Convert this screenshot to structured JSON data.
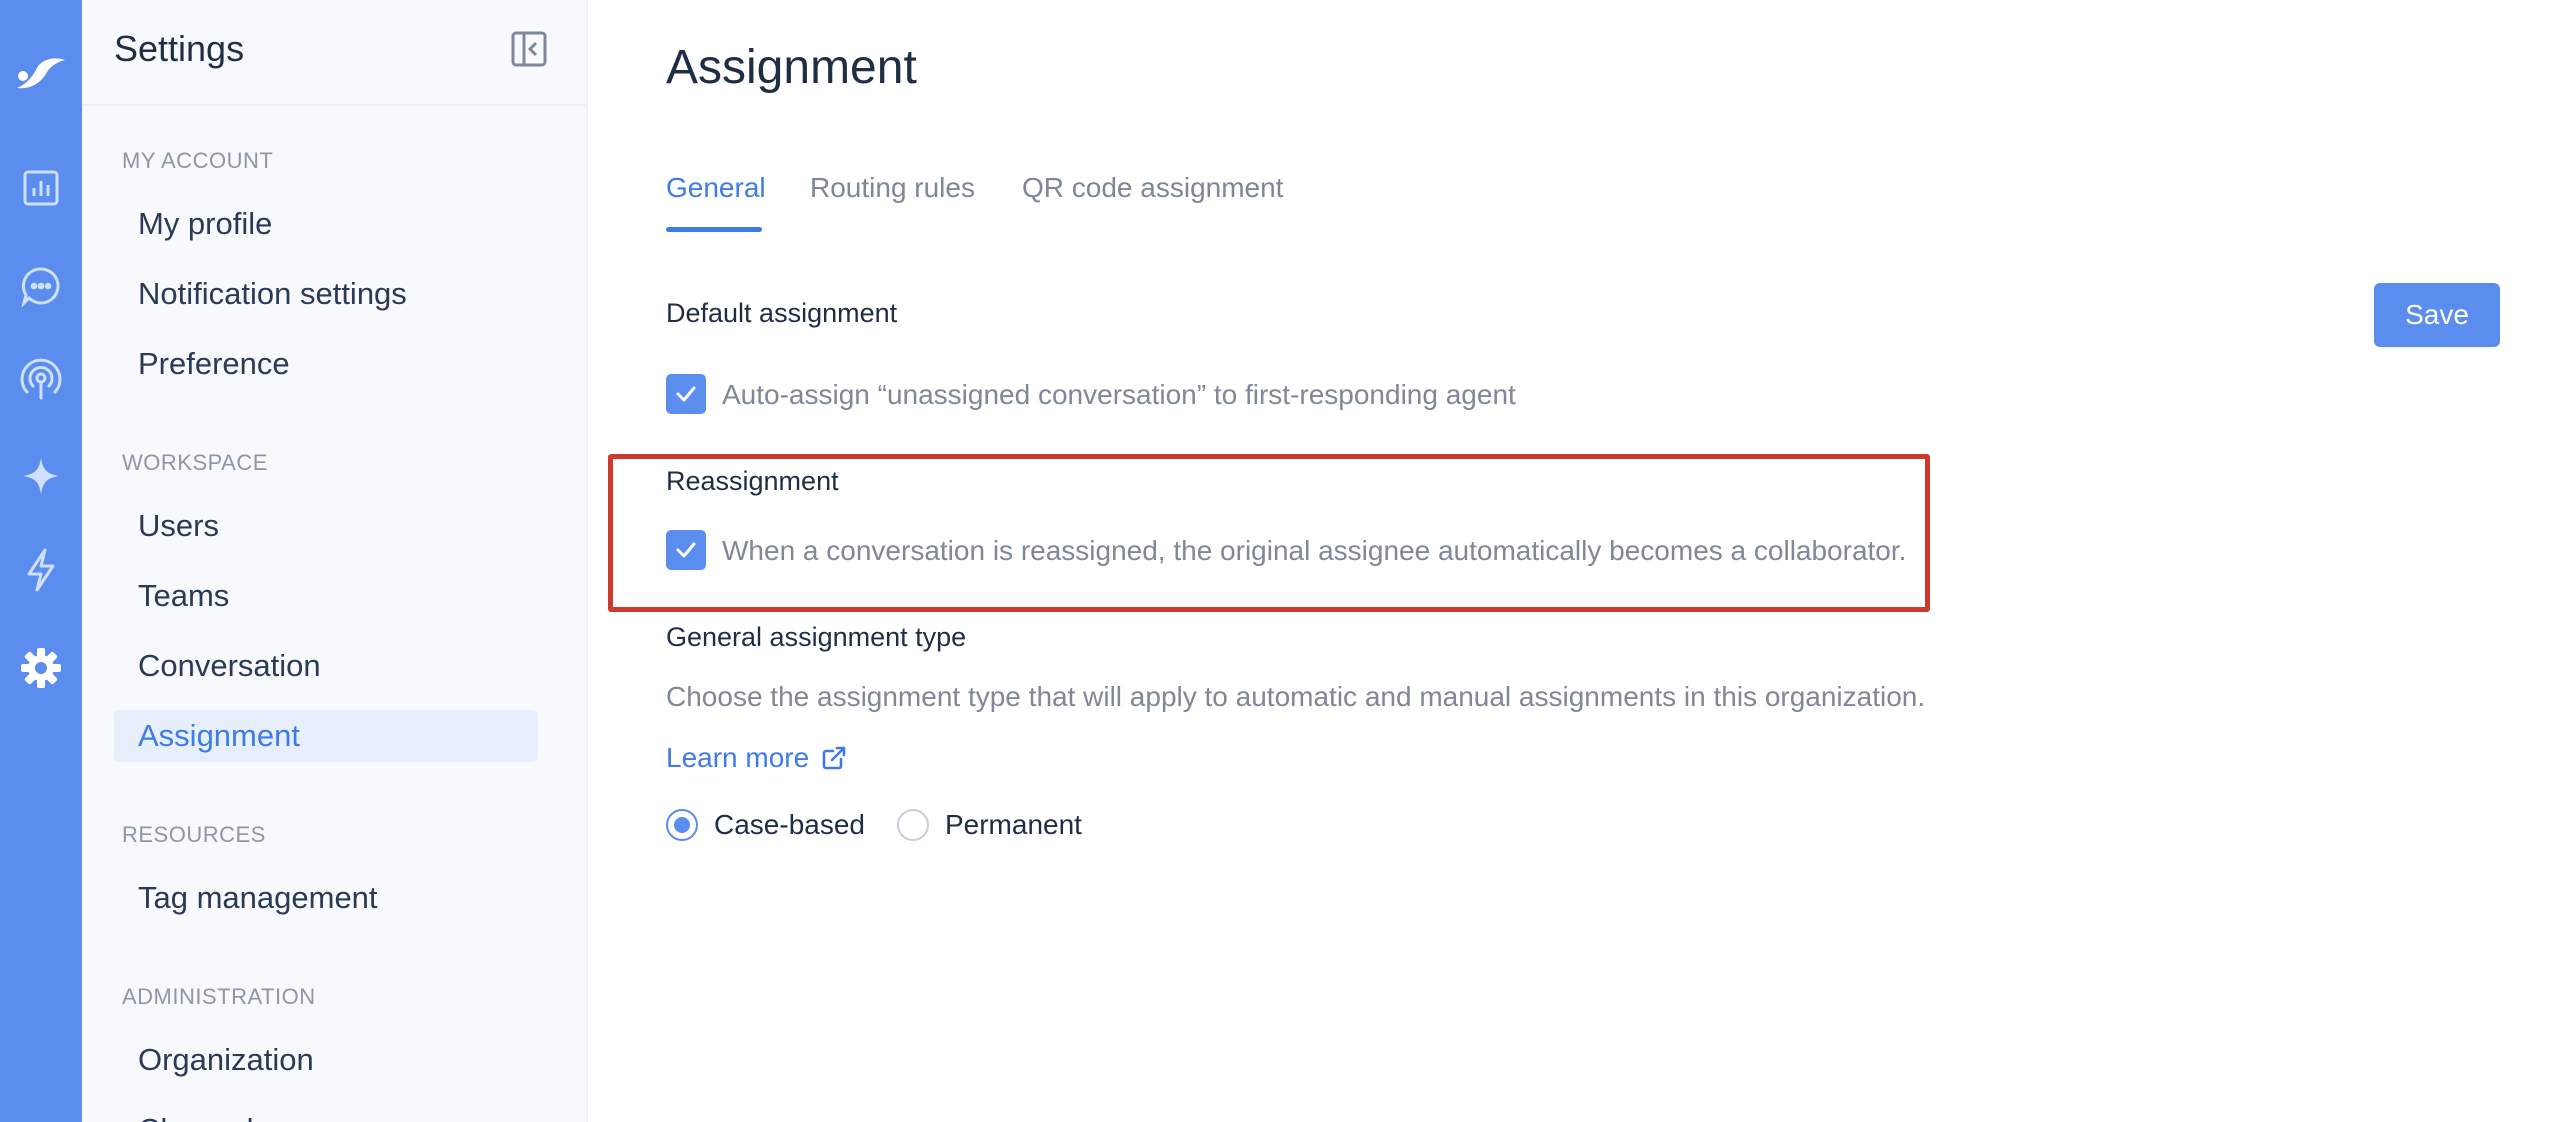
{
  "colors": {
    "primary": "#5b8def",
    "accent_text": "#3f7be6",
    "highlight_border": "#cc3a2d",
    "panel_bg": "#f7f9fc"
  },
  "rail": {
    "icons": [
      "logo-icon",
      "analytics-icon",
      "chat-icon",
      "broadcast-icon",
      "ai-sparkle-icon",
      "automation-bolt-icon",
      "settings-gear-icon"
    ]
  },
  "settings_panel": {
    "title": "Settings",
    "sections": [
      {
        "heading": "MY ACCOUNT",
        "items": [
          "My profile",
          "Notification settings",
          "Preference"
        ]
      },
      {
        "heading": "WORKSPACE",
        "items": [
          "Users",
          "Teams",
          "Conversation",
          "Assignment"
        ]
      },
      {
        "heading": "RESOURCES",
        "items": [
          "Tag management"
        ]
      },
      {
        "heading": "ADMINISTRATION",
        "items": [
          "Organization",
          "Channels"
        ]
      }
    ],
    "active_item": "Assignment"
  },
  "main": {
    "title": "Assignment",
    "tabs": [
      {
        "label": "General",
        "active": true
      },
      {
        "label": "Routing rules",
        "active": false
      },
      {
        "label": "QR code assignment",
        "active": false
      }
    ],
    "save_label": "Save",
    "default_assignment": {
      "label": "Default assignment",
      "checkbox_label": "Auto-assign “unassigned conversation” to first-responding agent",
      "checked": true
    },
    "reassignment": {
      "label": "Reassignment",
      "checkbox_label": "When a conversation is reassigned, the original assignee automatically becomes a collaborator.",
      "checked": true
    },
    "assignment_type": {
      "label": "General assignment type",
      "description": "Choose the assignment type that will apply to automatic and manual assignments in this organization.",
      "learn_more": "Learn more",
      "options": [
        "Case-based",
        "Permanent"
      ],
      "selected": "Case-based"
    }
  }
}
